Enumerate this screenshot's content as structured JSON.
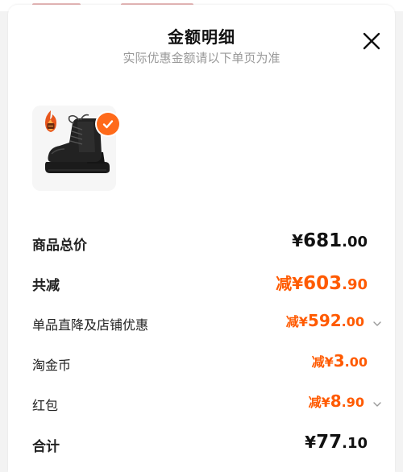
{
  "header": {
    "title": "金额明细",
    "subtitle": "实际优惠金额请以下单页为准"
  },
  "product": {
    "image_icon": "ankle-boot-image",
    "badge_icon": "flame-icon",
    "selected_icon": "check-circle-icon"
  },
  "rows": {
    "subtotal": {
      "label": "商品总价",
      "prefix": "¥",
      "integer": "681",
      "decimal": ".00"
    },
    "total_discount": {
      "label": "共减",
      "prefix": "减¥",
      "integer": "603",
      "decimal": ".90"
    },
    "store_discount": {
      "label": "单品直降及店铺优惠",
      "prefix": "减¥",
      "integer": "592",
      "decimal": ".00"
    },
    "coins": {
      "label": "淘金币",
      "prefix": "减¥",
      "integer": "3",
      "decimal": ".00"
    },
    "red_packet": {
      "label": "红包",
      "prefix": "减¥",
      "integer": "8",
      "decimal": ".90"
    },
    "total": {
      "label": "合计",
      "prefix": "¥",
      "integer": "77",
      "decimal": ".10"
    }
  },
  "colors": {
    "accent": "#ff5a00",
    "badge": "#ff6a1a",
    "text": "#222222",
    "subtext": "#999999"
  }
}
